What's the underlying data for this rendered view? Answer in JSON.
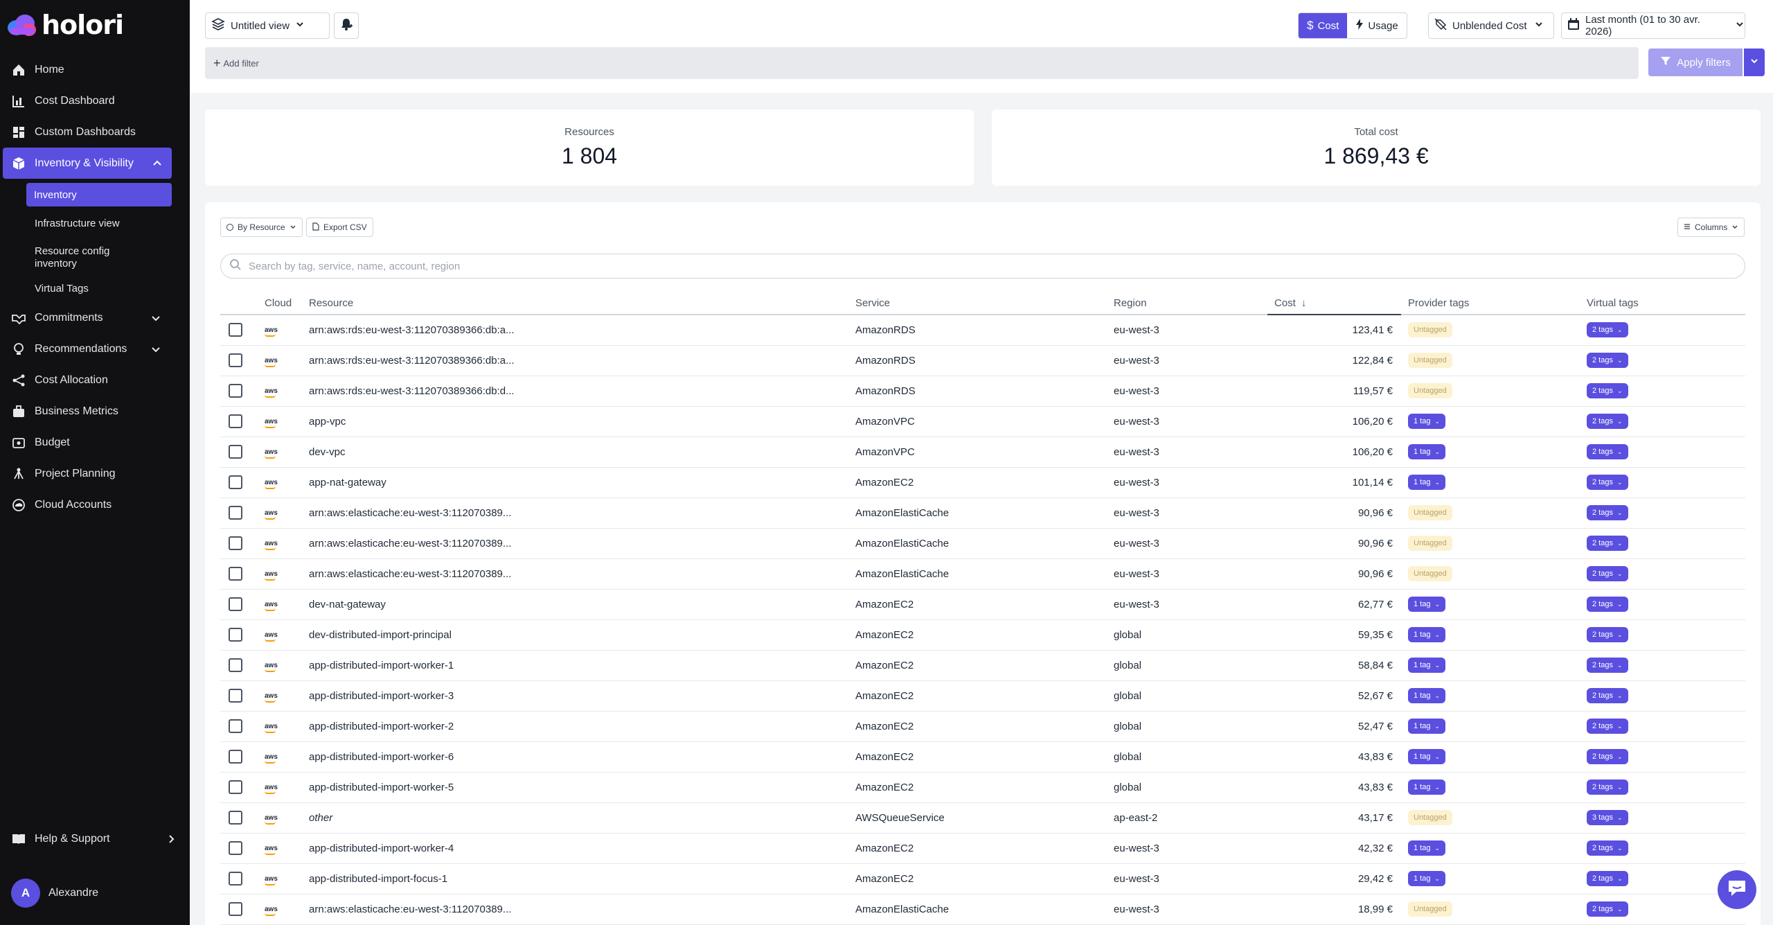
{
  "brand": {
    "name": "holori"
  },
  "sidebar": {
    "items": [
      {
        "label": "Home",
        "icon": "home-icon"
      },
      {
        "label": "Cost Dashboard",
        "icon": "bar-chart-icon"
      },
      {
        "label": "Custom Dashboards",
        "icon": "dashboard-grid-icon"
      },
      {
        "label": "Inventory & Visibility",
        "icon": "cube-icon"
      },
      {
        "label": "Commitments",
        "icon": "handshake-icon"
      },
      {
        "label": "Recommendations",
        "icon": "lightbulb-icon"
      },
      {
        "label": "Cost Allocation",
        "icon": "share-icon"
      },
      {
        "label": "Business Metrics",
        "icon": "briefcase-icon"
      },
      {
        "label": "Budget",
        "icon": "wallet-icon"
      },
      {
        "label": "Project Planning",
        "icon": "sitemap-icon"
      },
      {
        "label": "Cloud Accounts",
        "icon": "cloud-icon"
      }
    ],
    "subitems": [
      "Inventory",
      "Infrastructure view",
      "Resource config inventory",
      "Virtual Tags"
    ],
    "help": "Help & Support",
    "user": {
      "initial": "A",
      "name": "Alexandre"
    }
  },
  "toolbar": {
    "view": "Untitled view",
    "cost": "Cost",
    "usage": "Usage",
    "cost_type": "Unblended Cost",
    "date_range": "Last month (01 to 30 avr. 2026)",
    "add_filter": "Add filter",
    "apply": "Apply filters"
  },
  "stats": {
    "resources_label": "Resources",
    "resources_value": "1 804",
    "cost_label": "Total cost",
    "cost_value": "1 869,43 €"
  },
  "table_controls": {
    "group_by": "By Resource",
    "export": "Export CSV",
    "columns": "Columns",
    "search_placeholder": "Search by tag, service, name, account, region"
  },
  "columns": [
    "Cloud",
    "Resource",
    "Service",
    "Region",
    "Cost",
    "Provider tags",
    "Virtual tags"
  ],
  "cloud_label": "aws",
  "rows": [
    {
      "resource": "arn:aws:rds:eu-west-3:112070389366:db:a...",
      "service": "AmazonRDS",
      "region": "eu-west-3",
      "cost": "123,41 €",
      "ptag": "Untagged",
      "vtag": "2 tags"
    },
    {
      "resource": "arn:aws:rds:eu-west-3:112070389366:db:a...",
      "service": "AmazonRDS",
      "region": "eu-west-3",
      "cost": "122,84 €",
      "ptag": "Untagged",
      "vtag": "2 tags"
    },
    {
      "resource": "arn:aws:rds:eu-west-3:112070389366:db:d...",
      "service": "AmazonRDS",
      "region": "eu-west-3",
      "cost": "119,57 €",
      "ptag": "Untagged",
      "vtag": "2 tags"
    },
    {
      "resource": "app-vpc",
      "service": "AmazonVPC",
      "region": "eu-west-3",
      "cost": "106,20 €",
      "ptag": "1 tag",
      "vtag": "2 tags"
    },
    {
      "resource": "dev-vpc",
      "service": "AmazonVPC",
      "region": "eu-west-3",
      "cost": "106,20 €",
      "ptag": "1 tag",
      "vtag": "2 tags"
    },
    {
      "resource": "app-nat-gateway",
      "service": "AmazonEC2",
      "region": "eu-west-3",
      "cost": "101,14 €",
      "ptag": "1 tag",
      "vtag": "2 tags"
    },
    {
      "resource": "arn:aws:elasticache:eu-west-3:112070389...",
      "service": "AmazonElastiCache",
      "region": "eu-west-3",
      "cost": "90,96 €",
      "ptag": "Untagged",
      "vtag": "2 tags"
    },
    {
      "resource": "arn:aws:elasticache:eu-west-3:112070389...",
      "service": "AmazonElastiCache",
      "region": "eu-west-3",
      "cost": "90,96 €",
      "ptag": "Untagged",
      "vtag": "2 tags"
    },
    {
      "resource": "arn:aws:elasticache:eu-west-3:112070389...",
      "service": "AmazonElastiCache",
      "region": "eu-west-3",
      "cost": "90,96 €",
      "ptag": "Untagged",
      "vtag": "2 tags"
    },
    {
      "resource": "dev-nat-gateway",
      "service": "AmazonEC2",
      "region": "eu-west-3",
      "cost": "62,77 €",
      "ptag": "1 tag",
      "vtag": "2 tags"
    },
    {
      "resource": "dev-distributed-import-principal",
      "service": "AmazonEC2",
      "region": "global",
      "cost": "59,35 €",
      "ptag": "1 tag",
      "vtag": "2 tags"
    },
    {
      "resource": "app-distributed-import-worker-1",
      "service": "AmazonEC2",
      "region": "global",
      "cost": "58,84 €",
      "ptag": "1 tag",
      "vtag": "2 tags"
    },
    {
      "resource": "app-distributed-import-worker-3",
      "service": "AmazonEC2",
      "region": "global",
      "cost": "52,67 €",
      "ptag": "1 tag",
      "vtag": "2 tags"
    },
    {
      "resource": "app-distributed-import-worker-2",
      "service": "AmazonEC2",
      "region": "global",
      "cost": "52,47 €",
      "ptag": "1 tag",
      "vtag": "2 tags"
    },
    {
      "resource": "app-distributed-import-worker-6",
      "service": "AmazonEC2",
      "region": "global",
      "cost": "43,83 €",
      "ptag": "1 tag",
      "vtag": "2 tags"
    },
    {
      "resource": "app-distributed-import-worker-5",
      "service": "AmazonEC2",
      "region": "global",
      "cost": "43,83 €",
      "ptag": "1 tag",
      "vtag": "2 tags"
    },
    {
      "resource": "other",
      "service": "AWSQueueService",
      "region": "ap-east-2",
      "cost": "43,17 €",
      "ptag": "Untagged",
      "vtag": "3 tags",
      "italic": true
    },
    {
      "resource": "app-distributed-import-worker-4",
      "service": "AmazonEC2",
      "region": "eu-west-3",
      "cost": "42,32 €",
      "ptag": "1 tag",
      "vtag": "2 tags"
    },
    {
      "resource": "app-distributed-import-focus-1",
      "service": "AmazonEC2",
      "region": "eu-west-3",
      "cost": "29,42 €",
      "ptag": "1 tag",
      "vtag": "2 tags"
    },
    {
      "resource": "arn:aws:elasticache:eu-west-3:112070389...",
      "service": "AmazonElastiCache",
      "region": "eu-west-3",
      "cost": "18,99 €",
      "ptag": "Untagged",
      "vtag": "2 tags"
    }
  ],
  "colors": {
    "accent": "#5b4fe0",
    "sidebar": "#111113",
    "untagged_bg": "#fdf2d0",
    "aws_orange": "#f59e0b"
  }
}
